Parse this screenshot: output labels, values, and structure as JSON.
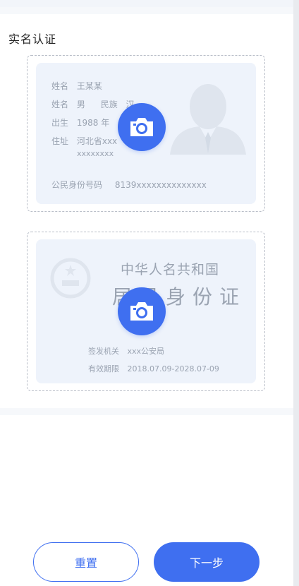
{
  "page": {
    "title": "实名认证"
  },
  "front": {
    "name_label": "姓名",
    "name_value": "王某某",
    "gender_label": "姓名",
    "gender_value": "男",
    "ethnic_label": "民族",
    "ethnic_value": "汉",
    "birth_label": "出生",
    "birth_value": "1988  年",
    "address_label": "住址",
    "address_value_1": "河北省xxx",
    "address_value_2": "xxxxxxxx",
    "idno_label": "公民身份号码",
    "idno_value": "8139xxxxxxxxxxxxxx"
  },
  "back": {
    "title": "中华人名共和国",
    "subtitle": "居民身份证",
    "issuer_label": "签发机关",
    "issuer_value": "xxx公安局",
    "validity_label": "有效期限",
    "validity_value": "2018.07.09-2028.07-09"
  },
  "icons": {
    "camera": "camera-icon",
    "portrait": "person-silhouette-icon",
    "emblem": "national-emblem-icon"
  },
  "buttons": {
    "reset": "重置",
    "next": "下一步"
  },
  "colors": {
    "primary": "#3f6ff0",
    "card_bg": "#eef3fb",
    "muted_text": "#9aa3b1"
  }
}
